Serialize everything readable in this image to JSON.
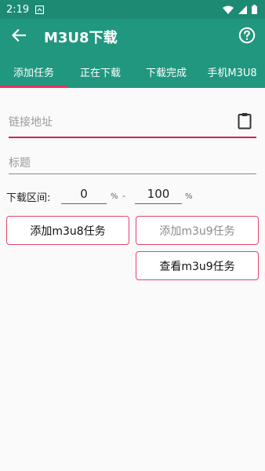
{
  "status_bar": {
    "time": "2:19",
    "icons": [
      "notification-icon",
      "wifi-icon",
      "signal-icon",
      "battery-icon"
    ]
  },
  "app_bar": {
    "title": "M3U8下载",
    "back_icon": "arrow-back-icon",
    "help_icon": "help-circle-icon"
  },
  "tabs": [
    {
      "label": "添加任务",
      "active": true
    },
    {
      "label": "正在下载",
      "active": false
    },
    {
      "label": "下载完成",
      "active": false
    },
    {
      "label": "手机M3U8",
      "active": false
    }
  ],
  "form": {
    "url_placeholder": "链接地址",
    "url_value": "",
    "clipboard_icon": "clipboard-icon",
    "title_placeholder": "标题",
    "title_value": "",
    "range_label": "下载区间:",
    "range_from": "0",
    "range_to": "100",
    "percent_symbol": "%",
    "range_separator": "-"
  },
  "buttons": {
    "add_m3u8": "添加m3u8任务",
    "add_m3u9": "添加m3u9任务",
    "view_m3u9": "查看m3u9任务"
  },
  "colors": {
    "app_bar": "#21977f",
    "status_bar": "#1d8a74",
    "accent": "#e8305c",
    "background": "#fafafa"
  }
}
